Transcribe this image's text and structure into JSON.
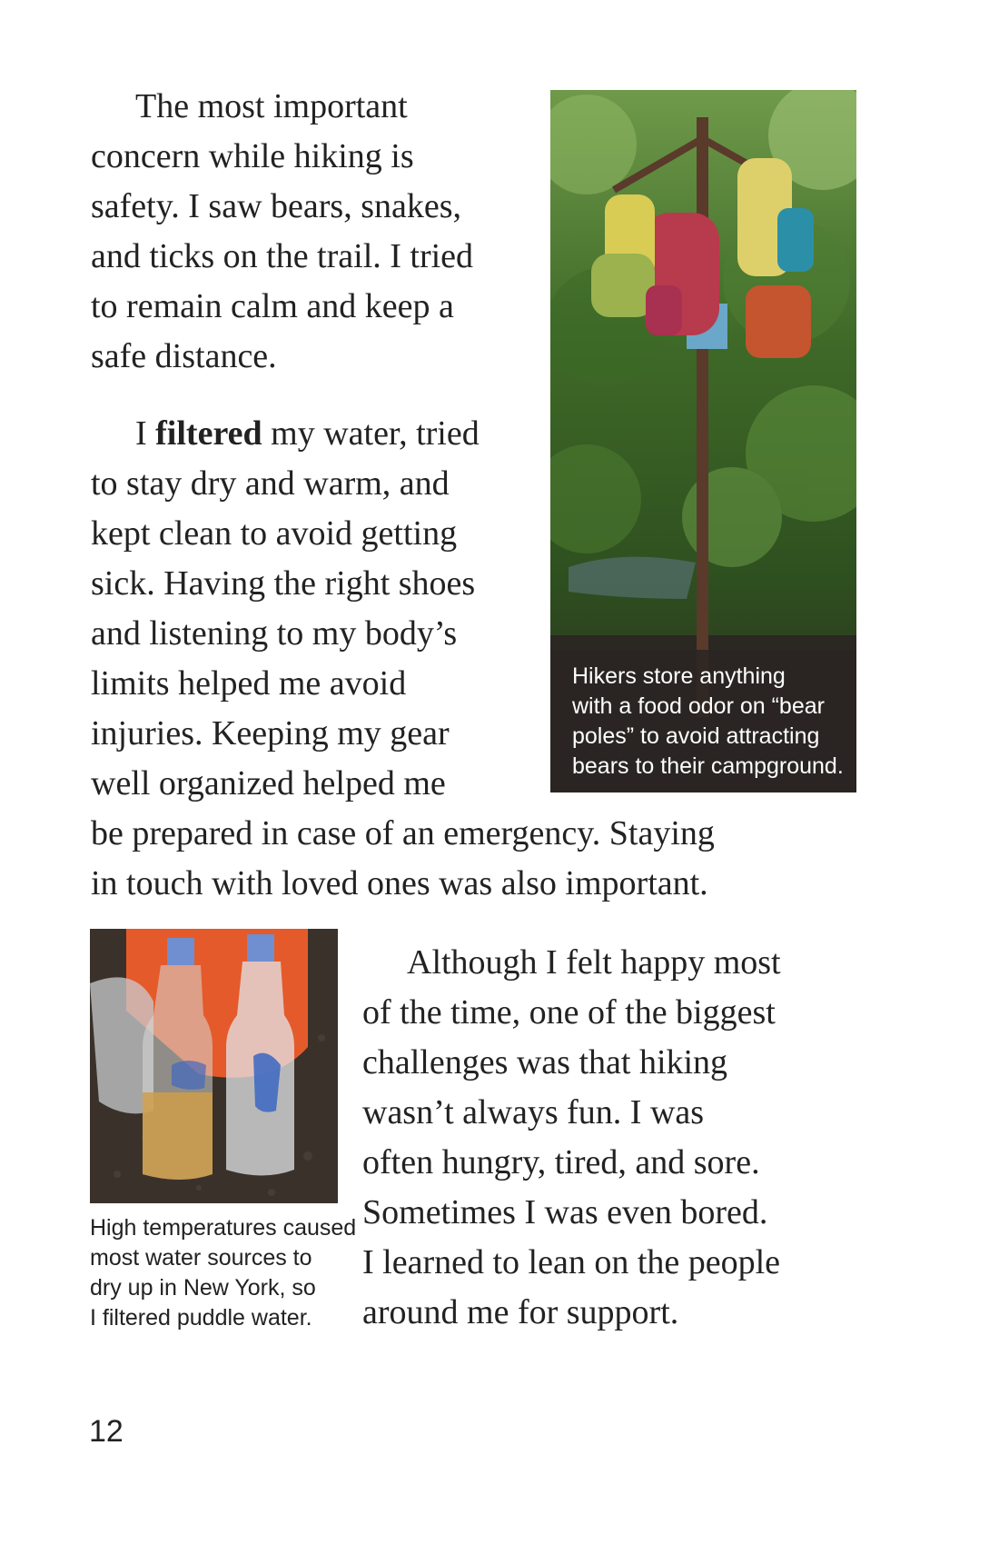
{
  "paragraph1": {
    "lines": [
      "The most important",
      "concern while hiking is",
      "safety. I saw bears, snakes,",
      "and ticks on the trail. I tried",
      "to remain calm and keep a",
      "safe distance."
    ]
  },
  "paragraph2": {
    "first_word": "I ",
    "bold_word": "filtered",
    "first_line_rest": " my water, tried",
    "lines": [
      "to stay dry and warm, and",
      "kept clean to avoid getting",
      "sick. Having the right shoes",
      "and listening to my body’s",
      "limits helped me avoid",
      "injuries. Keeping my gear",
      "well organized helped me",
      "be prepared in case of an emergency. Staying",
      "in touch with loved ones was also important."
    ]
  },
  "paragraph3": {
    "lines": [
      "Although I felt happy most",
      "of the time, one of the biggest",
      "challenges was that hiking",
      "wasn’t always fun. I was",
      "often hungry, tired, and sore.",
      "Sometimes I was even bored.",
      "I learned to lean on the people",
      "around me for support."
    ]
  },
  "bear_pole_photo": {
    "caption_lines": [
      "Hikers store anything",
      "with a food odor on “bear",
      "poles” to avoid attracting",
      "bears to their campground."
    ]
  },
  "water_photo": {
    "caption_lines": [
      "High temperatures caused",
      "most water sources to",
      "dry up in New York, so",
      "I filtered puddle water."
    ]
  },
  "page_number": "12"
}
